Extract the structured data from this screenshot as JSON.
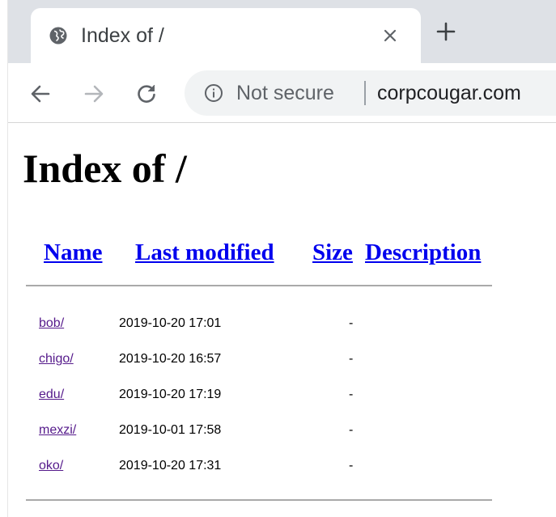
{
  "browser": {
    "tab": {
      "title": "Index of /"
    },
    "address_bar": {
      "security_label": "Not secure",
      "url": "corpcougar.com"
    }
  },
  "page": {
    "heading": "Index of /",
    "columns": [
      "Name",
      "Last modified",
      "Size",
      "Description"
    ],
    "entries": [
      {
        "name": "bob/",
        "modified": "2019-10-20 17:01",
        "size": "-",
        "description": ""
      },
      {
        "name": "chigo/",
        "modified": "2019-10-20 16:57",
        "size": "-",
        "description": ""
      },
      {
        "name": "edu/",
        "modified": "2019-10-20 17:19",
        "size": "-",
        "description": ""
      },
      {
        "name": "mexzi/",
        "modified": "2019-10-01 17:58",
        "size": "-",
        "description": ""
      },
      {
        "name": "oko/",
        "modified": "2019-10-20 17:31",
        "size": "-",
        "description": ""
      }
    ]
  },
  "colors": {
    "link": "#0000ee",
    "visited_link": "#551a8b",
    "tabstrip": "#dee1e6",
    "omnibox": "#f1f3f4"
  },
  "icons": {
    "tab_favicon": "globe-icon",
    "tab_close": "close-icon",
    "new_tab": "plus-icon",
    "back": "back-arrow-icon",
    "forward": "forward-arrow-icon",
    "reload": "reload-icon",
    "site_info": "info-icon"
  }
}
